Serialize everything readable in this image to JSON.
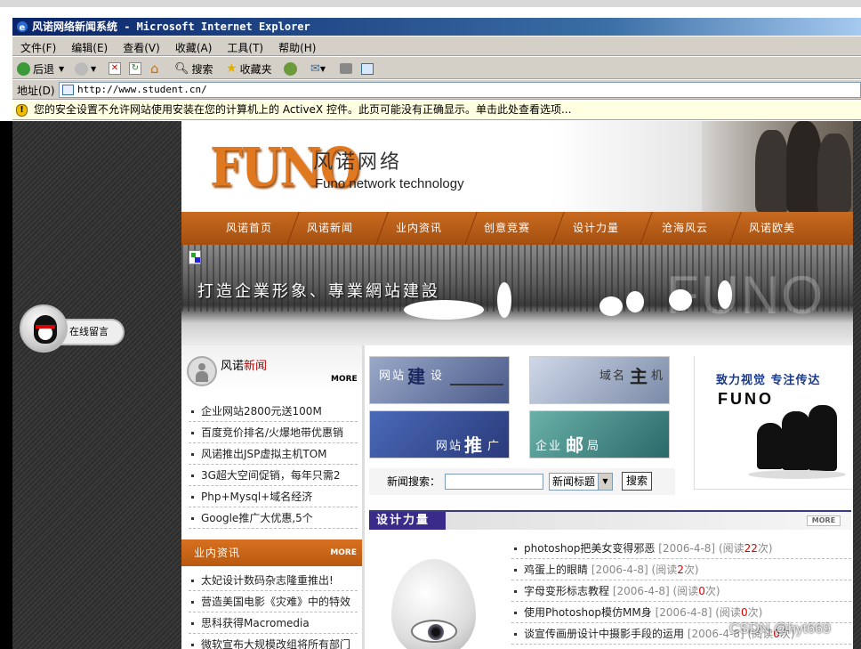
{
  "window": {
    "title": "风诺网络新闻系统 - Microsoft Internet Explorer"
  },
  "menu": [
    "文件(F)",
    "编辑(E)",
    "查看(V)",
    "收藏(A)",
    "工具(T)",
    "帮助(H)"
  ],
  "toolbar": {
    "back": "后退",
    "search": "搜索",
    "favorites": "收藏夹"
  },
  "address": {
    "label": "地址(D)",
    "url": "http://www.student.cn/"
  },
  "infobar": {
    "text": "您的安全设置不允许网站使用安装在您的计算机上的 ActiveX 控件。此页可能没有正确显示。单击此处查看选项..."
  },
  "qq": {
    "label": "在线留言"
  },
  "site": {
    "logo": "FUNO",
    "brand_cn": "风诺网络",
    "brand_en": "Funo network technology",
    "nav": [
      "风诺首页",
      "风诺新闻",
      "业内资讯",
      "创意竞赛",
      "设计力量",
      "沧海风云",
      "风诺欧美"
    ],
    "slogan": "打造企業形象、專業網站建設",
    "watermark": "FUNO",
    "news": {
      "title_a": "风诺",
      "title_b": "新闻",
      "more": "MORE",
      "items": [
        "企业网站2800元送100M",
        "百度竞价排名/火爆地带优惠销",
        "风诺推出JSP虚拟主机TOM",
        "3G超大空间促销，每年只需2",
        "Php+Mysql+域名经济",
        "Google推广大优惠,5个"
      ]
    },
    "industry": {
      "title": "业内资讯",
      "more": "MORE",
      "items": [
        "太妃设计数码杂志隆重推出!",
        "营造美国电影《灾难》中的特效",
        "思科获得Macromedia",
        "微软宣布大规模改组将所有部门"
      ]
    },
    "tiles": [
      {
        "a": "网站",
        "b": "建",
        "c": "设"
      },
      {
        "a": "域名",
        "b": "主",
        "c": "机"
      },
      {
        "a": "网站",
        "b": "推",
        "c": "广"
      },
      {
        "a": "企业",
        "b": "邮",
        "c": "局"
      }
    ],
    "search": {
      "label": "新闻搜索：",
      "select": "新闻标题",
      "button": "搜索"
    },
    "promo": {
      "slogan": "致力视觉 专注传达",
      "brand": "FUNO"
    },
    "design": {
      "title": "设计力量",
      "more": "MORE",
      "items": [
        {
          "title": "photoshop把美女变得邪恶",
          "date": "[2006-4-8]",
          "reads_a": "(阅读",
          "reads": "22",
          "reads_b": "次)"
        },
        {
          "title": "鸡蛋上的眼睛",
          "date": "[2006-4-8]",
          "reads_a": "(阅读",
          "reads": "2",
          "reads_b": "次)"
        },
        {
          "title": "字母变形标志教程",
          "date": "[2006-4-8]",
          "reads_a": "(阅读",
          "reads": "0",
          "reads_b": "次)"
        },
        {
          "title": "使用Photoshop模仿MM身",
          "date": "[2006-4-8]",
          "reads_a": "(阅读",
          "reads": "0",
          "reads_b": "次)"
        },
        {
          "title": "谈宣传画册设计中摄影手段的运用",
          "date": "[2006-4-8]",
          "reads_a": "(阅读",
          "reads": "0",
          "reads_b": "次)"
        }
      ]
    }
  },
  "overlay_watermark": "CSDN @hyt669"
}
